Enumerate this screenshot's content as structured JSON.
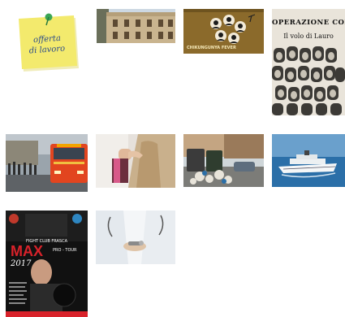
{
  "gallery": {
    "items": [
      {
        "name": "sticky-note-job-offer",
        "text": "offerta di lavoro",
        "line1": "offerta",
        "line2": "di lavoro"
      },
      {
        "name": "building-facade"
      },
      {
        "name": "chikungunya-poster",
        "text": "CHIKUNGUNYA FEVER"
      },
      {
        "name": "condor-book-cover",
        "title": "OPERAZIONE CONDOR",
        "subtitle": "Il volo di Lauro"
      },
      {
        "name": "bus-in-rain"
      },
      {
        "name": "harassment-scene"
      },
      {
        "name": "garbage-street"
      },
      {
        "name": "cruise-ship"
      },
      {
        "name": "fight-club-poster",
        "club": "FIGHT CLUB FRASCA",
        "headline": "MAX",
        "tour": "PRO - TOUR",
        "year": "2017"
      },
      {
        "name": "doctors-exchange"
      }
    ]
  },
  "colors": {
    "note": "#f3ea6d",
    "pin": "#3aa655",
    "poster_brown": "#8b6a2b",
    "fight_red": "#d8222a",
    "sea": "#2b6fa8"
  }
}
